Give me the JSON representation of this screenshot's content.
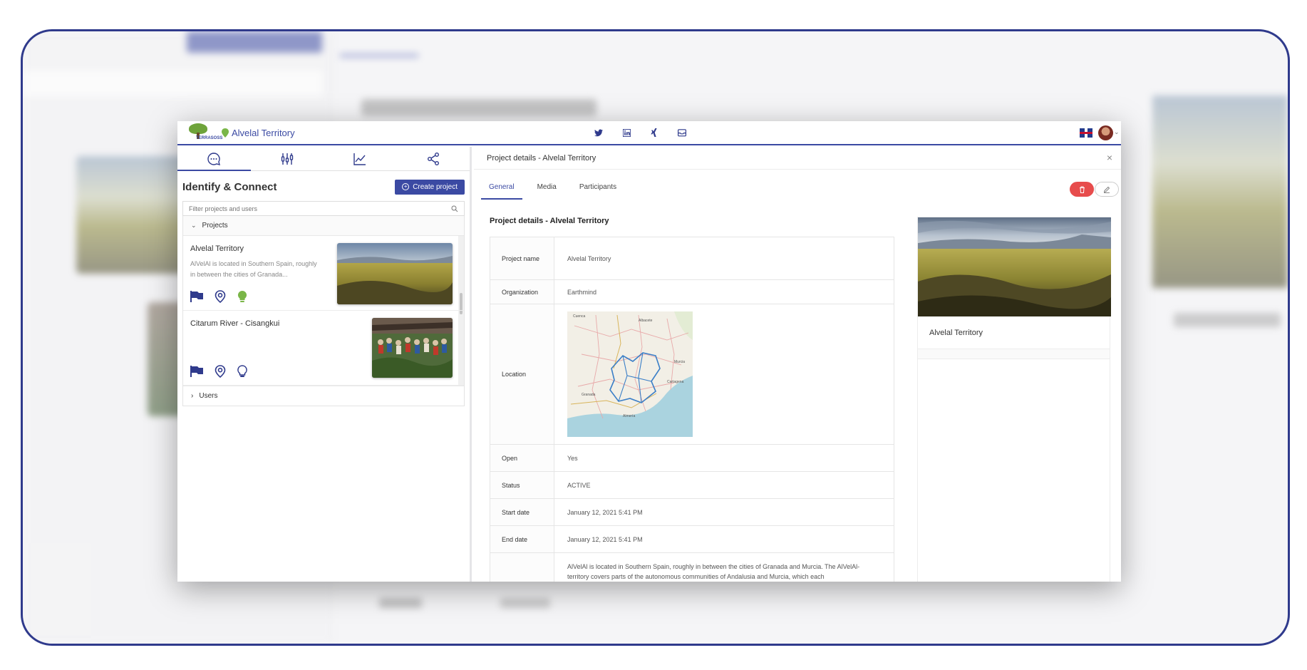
{
  "app": {
    "title": "Alvelal Territory",
    "logo_text": "TERRASOSS"
  },
  "topbar": {
    "social_icons": [
      "twitter-icon",
      "linkedin-icon",
      "xing-icon",
      "mail-icon"
    ],
    "language": "en-GB"
  },
  "left_panel": {
    "tabs": [
      "chat-icon",
      "sliders-icon",
      "chart-icon",
      "share-icon"
    ],
    "title": "Identify & Connect",
    "create_button": "Create project",
    "filter_placeholder": "Filter projects and users",
    "projects_section": "Projects",
    "projects": [
      {
        "name": "Alvelal Territory",
        "description": "AlVelAl is located in Southern Spain, roughly in between the cities of Granada..."
      },
      {
        "name": "Citarum River - Cisangkui",
        "description": ""
      }
    ],
    "users_section": "Users"
  },
  "details": {
    "header": "Project details - Alvelal Territory",
    "tabs": [
      "General",
      "Media",
      "Participants"
    ],
    "active_tab": "General",
    "content_title": "Project details - Alvelal Territory",
    "rows": {
      "project_name_label": "Project name",
      "project_name": "Alvelal Territory",
      "organization_label": "Organization",
      "organization": "Earthmind",
      "location_label": "Location",
      "open_label": "Open",
      "open": "Yes",
      "status_label": "Status",
      "status": "ACTIVE",
      "start_label": "Start date",
      "start": "January 12, 2021 5:41 PM",
      "end_label": "End date",
      "end": "January 12, 2021 5:41 PM",
      "description": "AlVelAl is located in Southern Spain, roughly in between the cities of Granada and Murcia. The AlVelAl- territory covers parts of the autonomous communities of Andalusia and Murcia, which each"
    },
    "map_labels": [
      "Cuenca",
      "Albacete",
      "Murcia",
      "Cartagena",
      "Granada",
      "Almería"
    ],
    "card_caption": "Alvelal Territory"
  },
  "colors": {
    "brand": "#3b4aa3",
    "delete": "#e74c4c",
    "accent_green": "#7ab648"
  }
}
